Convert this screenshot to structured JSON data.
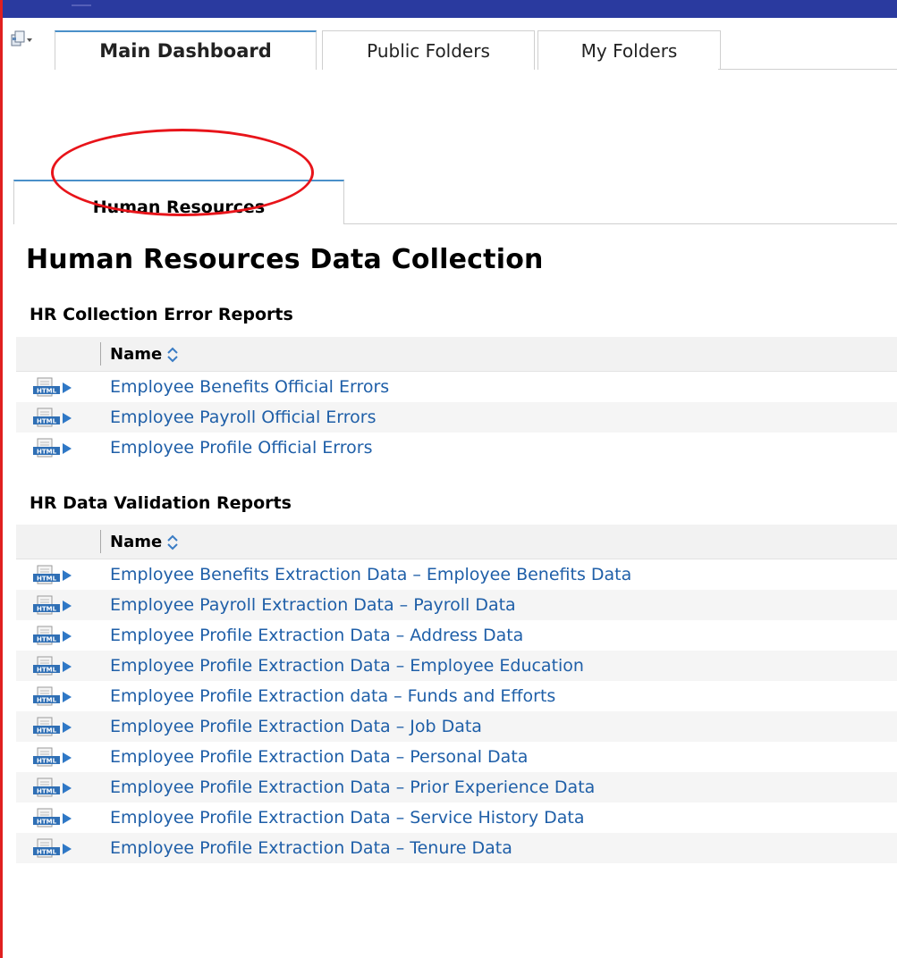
{
  "tabs": [
    {
      "label": "Main Dashboard",
      "active": true
    },
    {
      "label": "Public Folders",
      "active": false
    },
    {
      "label": "My Folders",
      "active": false
    }
  ],
  "section_tab": {
    "label": "Human Resources"
  },
  "page_title": "Human Resources Data Collection",
  "groups": [
    {
      "title": "HR Collection Error Reports",
      "column_header": "Name",
      "rows": [
        "Employee Benefits Official Errors",
        "Employee Payroll Official Errors",
        "Employee Profile Official Errors"
      ]
    },
    {
      "title": "HR Data Validation Reports",
      "column_header": "Name",
      "rows": [
        "Employee Benefits Extraction Data – Employee Benefits Data",
        "Employee Payroll Extraction Data – Payroll Data",
        "Employee Profile Extraction Data – Address Data",
        "Employee Profile Extraction Data – Employee Education",
        "Employee Profile Extraction data – Funds and Efforts",
        "Employee Profile Extraction Data – Job Data",
        "Employee Profile Extraction Data – Personal Data",
        "Employee Profile Extraction Data – Prior Experience Data",
        "Employee Profile Extraction Data – Service History Data",
        "Employee Profile Extraction Data – Tenure Data"
      ]
    }
  ],
  "icons": {
    "report": "html-report-icon",
    "sort": "sort-icon",
    "tabs_menu": "tabs-menu-icon"
  },
  "colors": {
    "link": "#1f5fa8",
    "title_bar": "#2a3a9f",
    "annotation": "#e8141a",
    "tab_accent": "#4a90c9"
  }
}
